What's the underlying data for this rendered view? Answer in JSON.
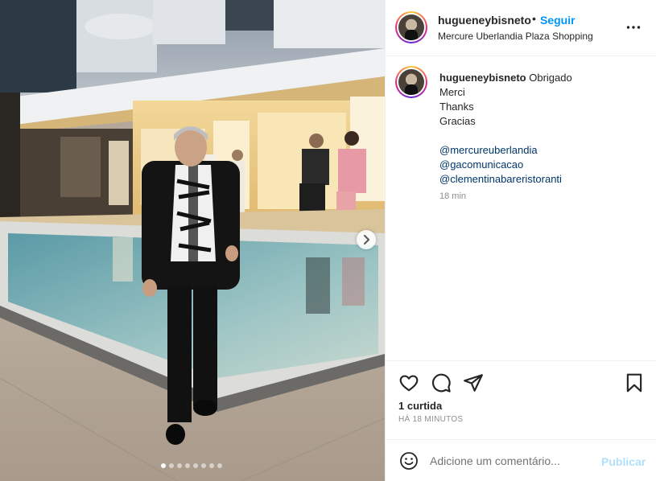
{
  "post": {
    "username": "hugueneybisneto",
    "separator": "•",
    "follow_label": "Seguir",
    "location": "Mercure Uberlandia Plaza Shopping"
  },
  "caption": {
    "username": "hugueneybisneto",
    "first_line": "Obrigado",
    "lines": [
      "Merci",
      "Thanks",
      "Gracias"
    ],
    "tags": [
      "@mercureuberlandia",
      "@gacomunicacao",
      "@clementinabareristoranti"
    ],
    "time": "18 min"
  },
  "engagement": {
    "likes": "1 curtida",
    "posted": "HÁ 18 MINUTOS"
  },
  "comment_box": {
    "placeholder": "Adicione um comentário...",
    "publish_label": "Publicar"
  },
  "carousel": {
    "total_slides": 8,
    "active_slide": 1
  },
  "icons": {
    "more": "more-horizontal-icon",
    "like": "heart-icon",
    "comment": "comment-icon",
    "share": "send-icon",
    "save": "bookmark-icon",
    "emoji": "emoji-icon",
    "next": "chevron-right-icon"
  },
  "colors": {
    "accent": "#0095f6",
    "publish_disabled": "#b2dffc",
    "mention": "#00376b",
    "muted": "#8e8e8e"
  }
}
